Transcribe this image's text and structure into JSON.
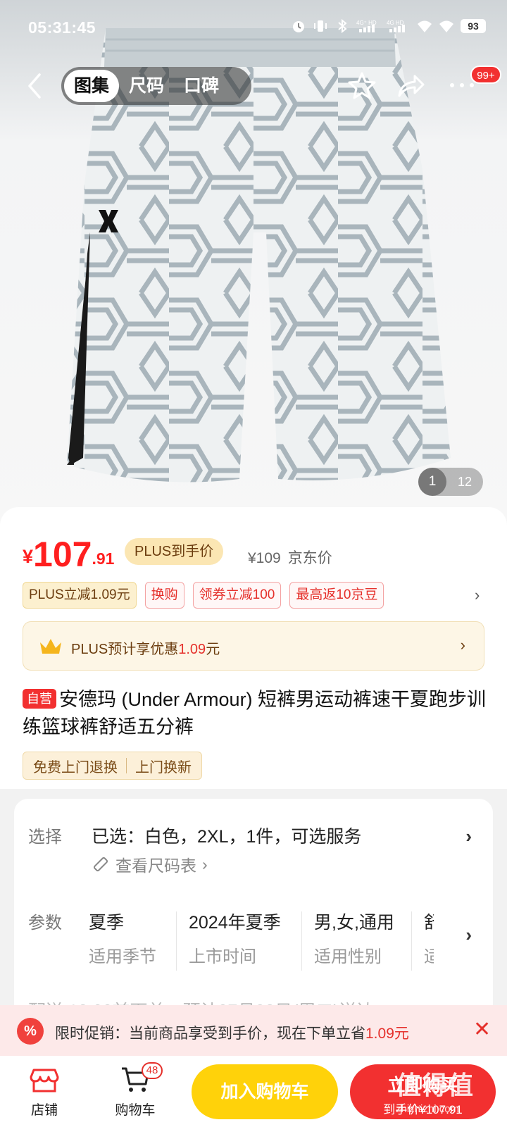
{
  "status_bar": {
    "time": "05:31:45",
    "battery": "93",
    "icons": [
      "alarm-icon",
      "vibrate-icon",
      "bluetooth-icon",
      "signal-4g-hd-icon",
      "signal-4g-hd-icon",
      "wifi-icon",
      "wifi-icon"
    ],
    "net1": "4G⁺ HD",
    "net2": "4G HD"
  },
  "header": {
    "tabs": [
      "图集",
      "尺码",
      "口碑"
    ],
    "active_tab": 0,
    "message_badge": "99+"
  },
  "gallery": {
    "current": "1",
    "total": "12"
  },
  "price": {
    "symbol": "¥",
    "integer": "107",
    "decimal": ".91",
    "plus_label": "PLUS到手价",
    "jd_price": "¥109",
    "jd_label": "京东价"
  },
  "tags": [
    "PLUS立减1.09元",
    "换购",
    "领券立减100",
    "最高返10京豆"
  ],
  "plus_banner": {
    "text": "PLUS预计享优惠",
    "amount": "1.09",
    "unit": "元"
  },
  "product": {
    "badge": "自营",
    "title": "安德玛 (Under Armour) 短裤男运动裤速干夏跑步训练篮球裤舒适五分裤"
  },
  "services": [
    "免费上门退换",
    "上门换新"
  ],
  "spec": {
    "select_label": "选择",
    "selected_text": "已选：白色，2XL，1件，可选服务",
    "size_chart": "查看尺码表",
    "param_label": "参数",
    "params": [
      {
        "value": "夏季",
        "key": "适用季节"
      },
      {
        "value": "2024年夏季",
        "key": "上市时间"
      },
      {
        "value": "男,女,通用",
        "key": "适用性别"
      },
      {
        "value": "舒",
        "key": "适"
      }
    ],
    "row3_partial": "配送    18:00前下单，预计07月23日(周二)送达"
  },
  "promo": {
    "icon": "%",
    "text": "限时促销：当前商品享受到手价，现在下单立省",
    "amount": "1.09元"
  },
  "bottom_bar": {
    "store": "店铺",
    "cart": "购物车",
    "cart_count": "48",
    "add_to_cart": "加入购物车",
    "buy_now": "立即购买",
    "buy_sub": "到手价¥107.91"
  },
  "watermark": {
    "main": "值得值",
    "sub": "zhizhizhi.com"
  },
  "colors": {
    "accent_red": "#f23030",
    "cart_yellow": "#ffd20a",
    "plus_gold": "#fbe6b3"
  }
}
